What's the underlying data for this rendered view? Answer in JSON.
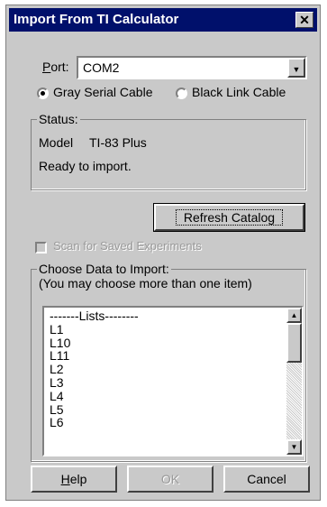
{
  "window": {
    "title": "Import From TI Calculator",
    "close_icon": "close-icon"
  },
  "port": {
    "label": "Port:",
    "value": "COM2"
  },
  "cable": {
    "gray_label": "Gray Serial Cable",
    "black_label": "Black Link Cable",
    "selected": "gray"
  },
  "status": {
    "legend": "Status:",
    "model_label": "Model",
    "model_value": "TI-83 Plus",
    "message": "Ready to import."
  },
  "refresh_button": "Refresh Catalog",
  "scan_checkbox": {
    "label": "Scan for Saved Experiments",
    "enabled": false,
    "checked": false
  },
  "import": {
    "legend": "Choose Data to Import:",
    "hint": "(You may choose more than one item)",
    "items": [
      "-------Lists--------",
      "L1",
      "L10",
      "L11",
      "L2",
      "L3",
      "L4",
      "L5",
      "L6"
    ]
  },
  "buttons": {
    "help": "Help",
    "ok": "OK",
    "cancel": "Cancel"
  }
}
